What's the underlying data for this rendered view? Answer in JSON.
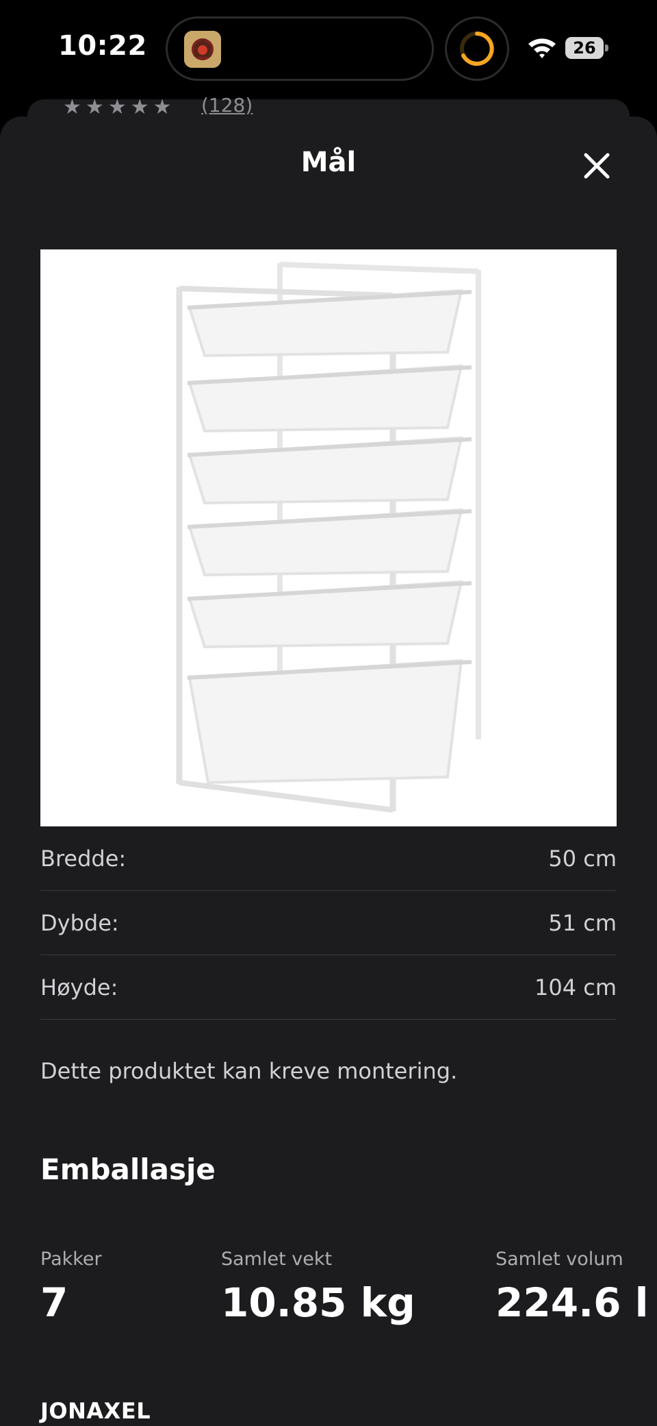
{
  "status": {
    "time": "10:22",
    "battery": "26"
  },
  "background": {
    "reviews": "(128)"
  },
  "sheet": {
    "title": "Mål",
    "dimensions": [
      {
        "label": "Bredde:",
        "value": "50 cm"
      },
      {
        "label": "Dybde:",
        "value": "51 cm"
      },
      {
        "label": "Høyde:",
        "value": "104 cm"
      }
    ],
    "note": "Dette produktet kan kreve montering.",
    "packaging": {
      "heading": "Emballasje",
      "stats": [
        {
          "label": "Pakker",
          "value": "7"
        },
        {
          "label": "Samlet vekt",
          "value": "10.85 kg"
        },
        {
          "label": "Samlet volum",
          "value": "224.6 l"
        }
      ]
    },
    "brand": "JONAXEL"
  },
  "colors": {
    "sheet_bg": "#1c1c1e",
    "divider": "#3a3a3c",
    "ring_accent": "#f5a623"
  }
}
